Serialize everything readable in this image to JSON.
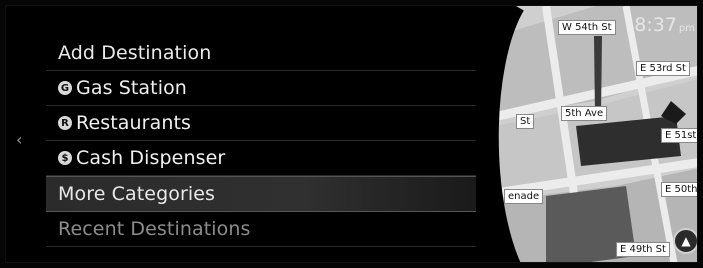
{
  "status": {
    "time": "8:37",
    "ampm": "pm"
  },
  "menu": {
    "title": "Add Destination",
    "items": [
      {
        "icon": "G",
        "label": "Gas Station"
      },
      {
        "icon": "R",
        "label": "Restaurants"
      },
      {
        "icon": "$",
        "label": "Cash Dispenser"
      }
    ],
    "more": "More Categories",
    "recent": "Recent Destinations"
  },
  "map": {
    "streets": {
      "w54": "W 54th St",
      "e53": "E 53rd St",
      "fifth": "5th Ave",
      "st": "St",
      "e51": "E 51st S",
      "e50": "E 50th S",
      "promenade": "enade",
      "e49": "E 49th St"
    },
    "colors": {
      "block": "#b9b9b9",
      "road": "#e9e9e9",
      "building": "#3a3a3a"
    }
  },
  "icons": {
    "back": "chevron-left-icon",
    "compass": "compass-icon"
  }
}
